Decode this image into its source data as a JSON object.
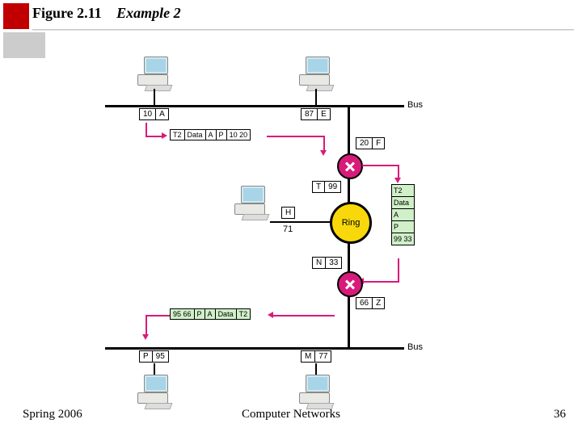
{
  "title": {
    "fig": "Figure 2.11",
    "example": "Example 2"
  },
  "footer": {
    "left": "Spring 2006",
    "center": "Computer Networks",
    "right": "36"
  },
  "labels": {
    "bus_top": "Bus",
    "bus_bottom": "Bus",
    "ring": "Ring",
    "A_addr": "10",
    "A_name": "A",
    "E_addr": "87",
    "E_name": "E",
    "F_addr": "20",
    "F_name": "F",
    "T_addr": "99",
    "T_name": "T",
    "H_addr": "71",
    "H_name": "H",
    "N_addr": "33",
    "N_name": "N",
    "Z_addr": "66",
    "Z_name": "Z",
    "P_addr": "95",
    "P_name": "P",
    "M_addr": "77",
    "M_name": "M"
  },
  "packets": {
    "top": [
      "T2",
      "Data",
      "A",
      "P",
      "10 20"
    ],
    "right": [
      "T2",
      "Data",
      "A",
      "P",
      "99 33"
    ],
    "bottom": [
      "95 66",
      "P",
      "A",
      "Data",
      "T2"
    ]
  }
}
